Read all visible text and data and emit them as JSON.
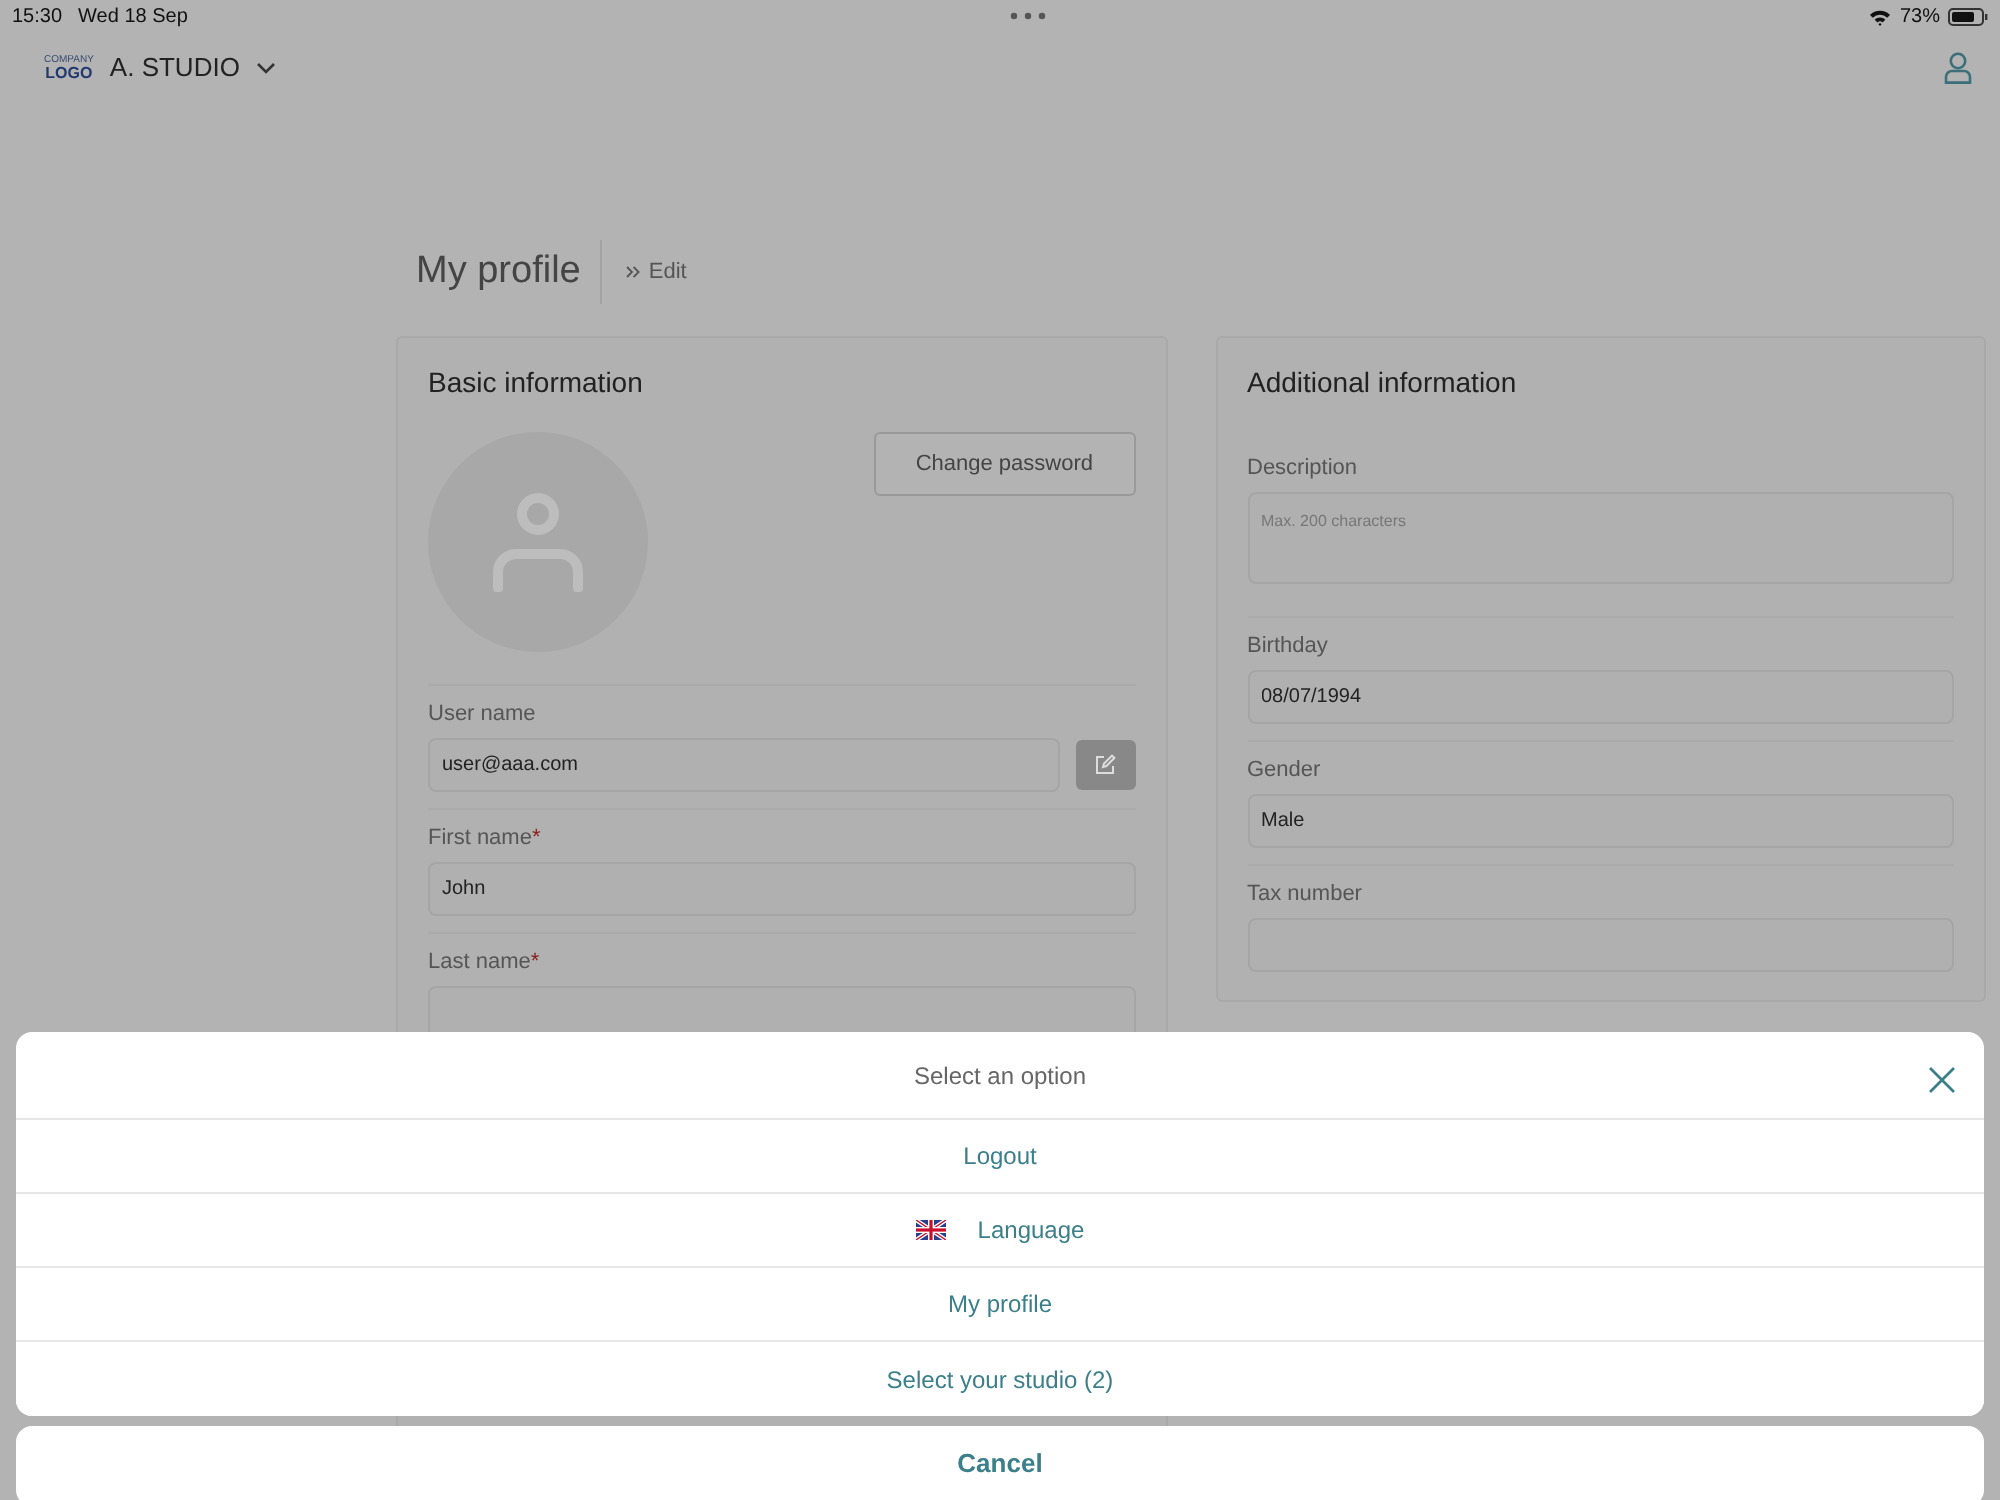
{
  "status_bar": {
    "time": "15:30",
    "date": "Wed 18 Sep",
    "battery": "73%"
  },
  "header": {
    "logo_top": "COMPANY",
    "logo_bottom": "LOGO",
    "studio": "A. STUDIO"
  },
  "page": {
    "title": "My profile",
    "breadcrumb": "Edit"
  },
  "basic": {
    "title": "Basic information",
    "change_password": "Change password",
    "fields": [
      {
        "label": "User name",
        "kind": "editable",
        "value": "user@aaa.com"
      },
      {
        "label": "First name",
        "kind": "text",
        "required_mark": "*",
        "value": "John"
      },
      {
        "label": "Last name",
        "kind": "text",
        "required_mark": "*"
      }
    ]
  },
  "additional": {
    "title": "Additional information",
    "fields": [
      {
        "label": "Description",
        "kind": "textarea",
        "placeholder": "Max. 200 characters"
      },
      {
        "label": "Birthday",
        "kind": "text",
        "value": "08/07/1994"
      },
      {
        "label": "Gender",
        "kind": "text",
        "value": "Male"
      },
      {
        "label": "Tax number",
        "kind": "text"
      }
    ]
  },
  "action_sheet": {
    "title": "Select an option",
    "options": [
      {
        "label": "Logout",
        "kind": "plain"
      },
      {
        "label": "Language",
        "kind": "flag"
      },
      {
        "label": "My profile",
        "kind": "plain"
      },
      {
        "label": "Select your studio (2)",
        "kind": "plain"
      }
    ],
    "cancel": "Cancel"
  }
}
